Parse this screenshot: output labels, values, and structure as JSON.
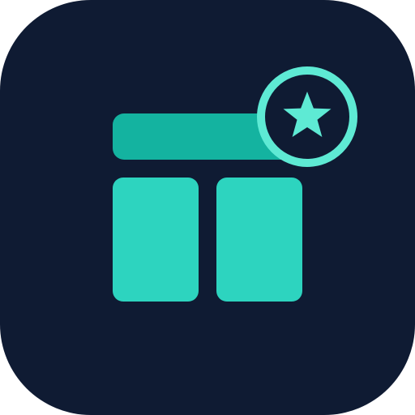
{
  "icon": {
    "name": "layout-favorite-app-icon",
    "colors": {
      "background": "#0F1B33",
      "header_bar": "#14B3A0",
      "panel": "#2DD4BF",
      "badge_fill": "#0F1B33",
      "badge_ring": "#5EEAD4",
      "star": "#5EEAD4"
    }
  }
}
